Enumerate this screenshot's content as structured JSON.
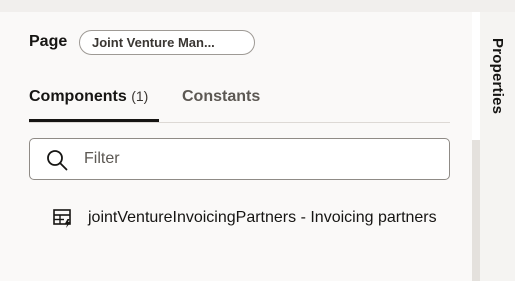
{
  "properties_tab": {
    "label": "Properties"
  },
  "page": {
    "label": "Page",
    "chip": "Joint Venture Man..."
  },
  "tabs": [
    {
      "label": "Components",
      "count": "(1)"
    },
    {
      "label": "Constants"
    }
  ],
  "search": {
    "placeholder": "Filter",
    "icon": "search-icon"
  },
  "components": [
    {
      "label": "jointVentureInvoicingPartners - Invoicing partners",
      "icon": "table-icon"
    }
  ]
}
